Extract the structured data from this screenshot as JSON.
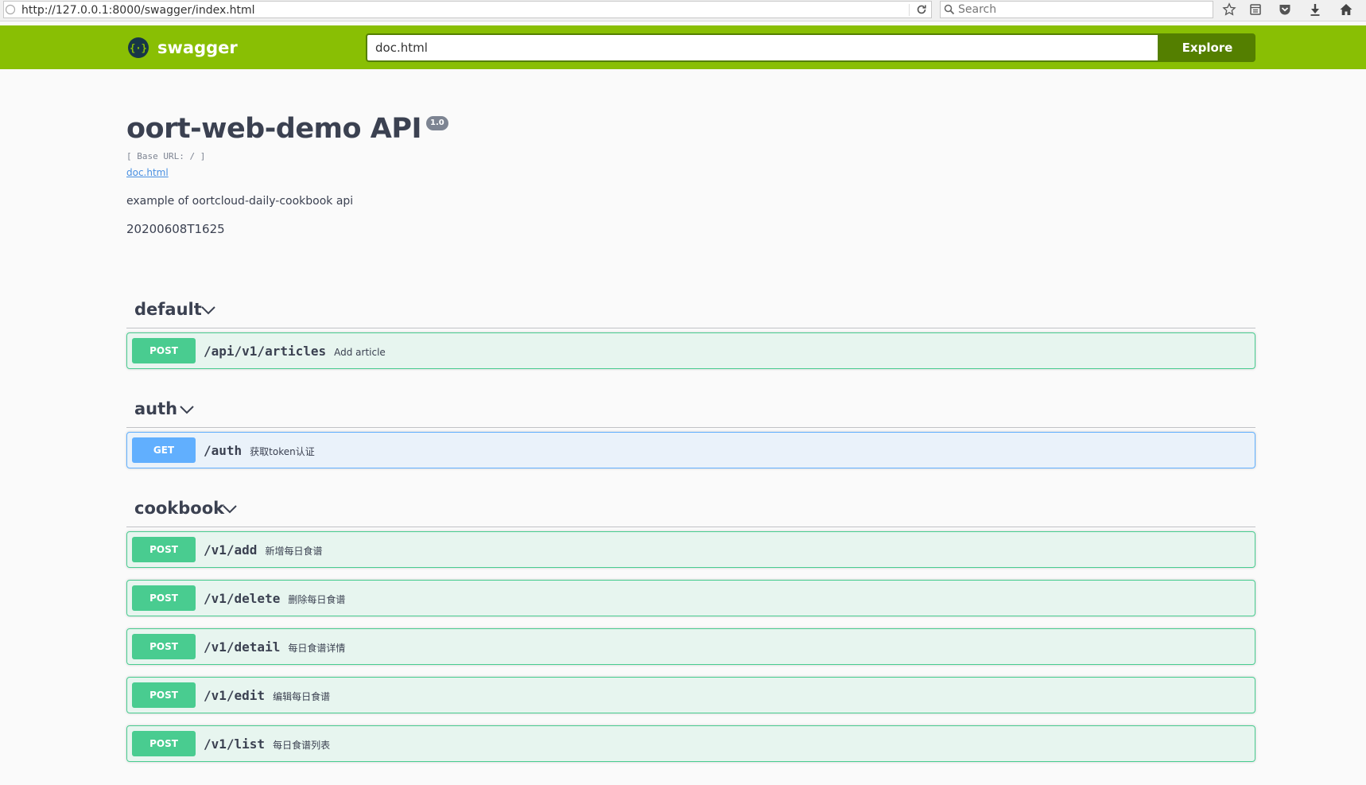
{
  "browser": {
    "url": "http://127.0.0.1:8000/swagger/index.html",
    "search_placeholder": "Search"
  },
  "topbar": {
    "logo_text": "swagger",
    "spec_url": "doc.html",
    "explore_label": "Explore"
  },
  "info": {
    "title": "oort-web-demo API",
    "version": "1.0",
    "base_url": "[ Base URL: / ]",
    "spec_link": "doc.html",
    "description": "example of oortcloud-daily-cookbook api",
    "build": "20200608T1625"
  },
  "tags": [
    {
      "name": "default",
      "operations": [
        {
          "method": "POST",
          "path": "/api/v1/articles",
          "summary": "Add article"
        }
      ]
    },
    {
      "name": "auth",
      "operations": [
        {
          "method": "GET",
          "path": "/auth",
          "summary": "获取token认证"
        }
      ]
    },
    {
      "name": "cookbook",
      "operations": [
        {
          "method": "POST",
          "path": "/v1/add",
          "summary": "新增每日食谱"
        },
        {
          "method": "POST",
          "path": "/v1/delete",
          "summary": "删除每日食谱"
        },
        {
          "method": "POST",
          "path": "/v1/detail",
          "summary": "每日食谱详情"
        },
        {
          "method": "POST",
          "path": "/v1/edit",
          "summary": "编辑每日食谱"
        },
        {
          "method": "POST",
          "path": "/v1/list",
          "summary": "每日食谱列表"
        }
      ]
    }
  ],
  "colors": {
    "topbar": "#89bf04",
    "explore": "#547f00",
    "post": "#49cc90",
    "get": "#61affe"
  }
}
